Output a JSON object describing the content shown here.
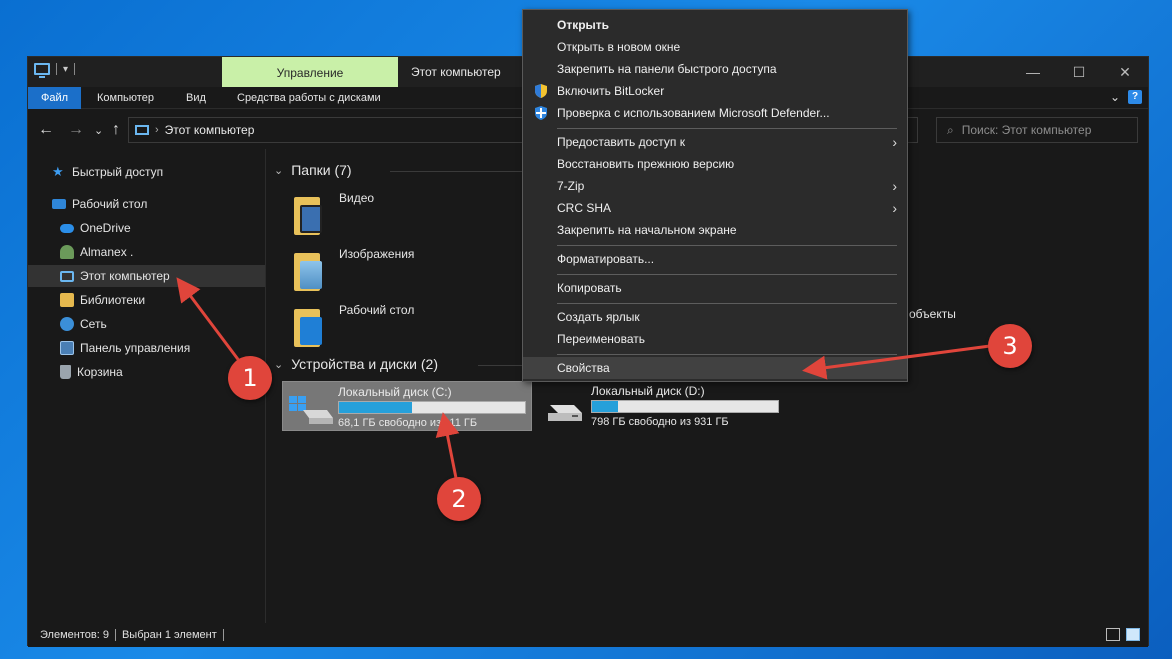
{
  "window": {
    "title": "Этот компьютер",
    "contextual_tab": "Управление",
    "controls": {
      "minimize": "—",
      "maximize": "☐",
      "close": "✕"
    }
  },
  "ribbon": {
    "tabs": [
      "Файл",
      "Компьютер",
      "Вид",
      "Средства работы с дисками"
    ]
  },
  "address": {
    "path": "Этот компьютер",
    "search_placeholder": "Поиск: Этот компьютер"
  },
  "sidebar": {
    "items": [
      {
        "label": "Быстрый доступ",
        "icon": "star-icon"
      },
      {
        "label": "Рабочий стол",
        "icon": "desktop-icon"
      },
      {
        "label": "OneDrive",
        "icon": "cloud-icon"
      },
      {
        "label": "Almanex .",
        "icon": "user-icon"
      },
      {
        "label": "Этот компьютер",
        "icon": "computer-icon"
      },
      {
        "label": "Библиотеки",
        "icon": "library-icon"
      },
      {
        "label": "Сеть",
        "icon": "network-icon"
      },
      {
        "label": "Панель управления",
        "icon": "control-panel-icon"
      },
      {
        "label": "Корзина",
        "icon": "recycle-bin-icon"
      }
    ]
  },
  "content": {
    "folders_header": "Папки (7)",
    "folders": [
      "Видео",
      "Изображения",
      "Рабочий стол"
    ],
    "partial_label": "объекты",
    "devices_header": "Устройства и диски (2)",
    "drives": [
      {
        "name": "Локальный диск (C:)",
        "free": "68,1 ГБ свободно из 111 ГБ",
        "used_fraction": 0.39
      },
      {
        "name": "Локальный диск (D:)",
        "free": "798 ГБ свободно из 931 ГБ",
        "used_fraction": 0.14
      }
    ]
  },
  "status": {
    "items_count": "Элементов: 9",
    "selected": "Выбран 1 элемент"
  },
  "context_menu": {
    "items": [
      "Открыть",
      "Открыть в новом окне",
      "Закрепить на панели быстрого доступа",
      "Включить BitLocker",
      "Проверка с использованием Microsoft Defender...",
      "Предоставить доступ к",
      "Восстановить прежнюю версию",
      "7-Zip",
      "CRC SHA",
      "Закрепить на начальном экране",
      "Форматировать...",
      "Копировать",
      "Создать ярлык",
      "Переименовать",
      "Свойства"
    ]
  },
  "annotations": {
    "one": "1",
    "two": "2",
    "three": "3"
  },
  "colors": {
    "accent": "#1b6fc9",
    "badge": "#e0453b",
    "drive_fill": "#26a0da",
    "contextual_tab": "#c9f0a8"
  }
}
